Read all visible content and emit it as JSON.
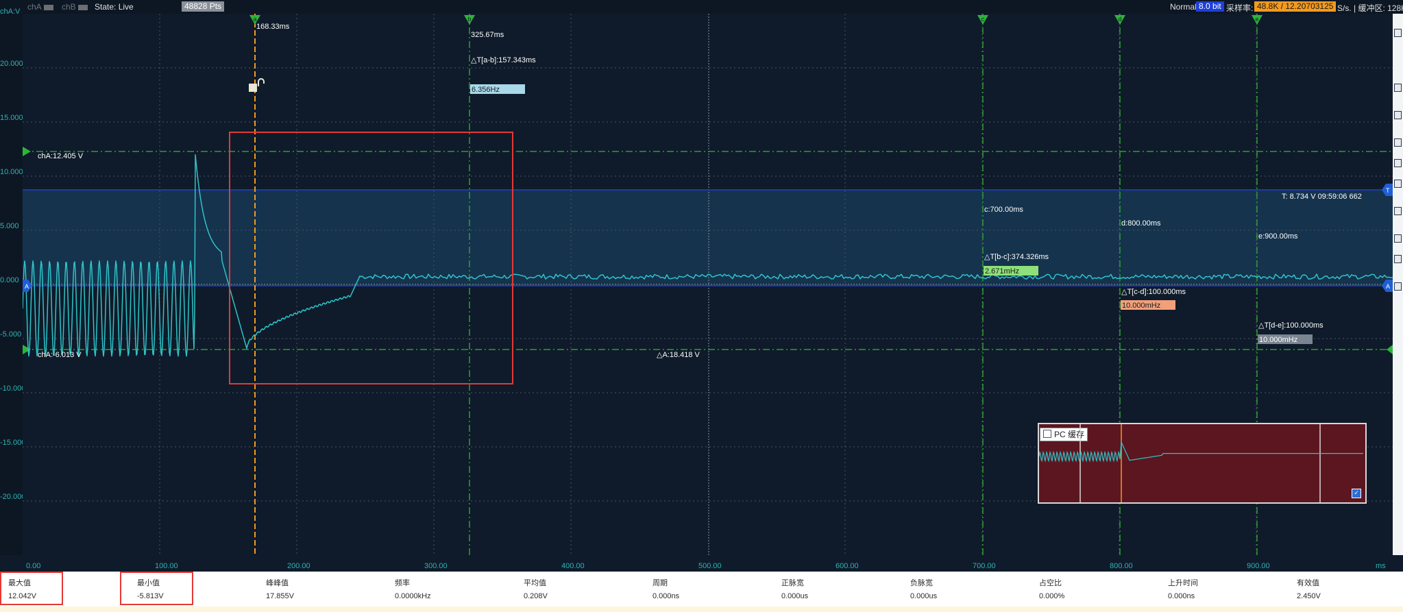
{
  "topbar": {
    "chA_label": "chA",
    "chB_label": "chB",
    "state": "State: Live",
    "points": "48828 Pts",
    "mode": "Normal",
    "bits": "8.0 bit",
    "sample_rate_label": "采样率:",
    "sample_rate_value": "48.8K / 12.20703125",
    "sample_rate_unit": "S/s. | 缓冲区: 128K"
  },
  "yaxis": {
    "unit": "chA:V",
    "labels": [
      "20.000",
      "15.000",
      "10.000",
      "5.000",
      "0.000",
      "-5.000",
      "-10.000",
      "-15.000",
      "-20.000"
    ]
  },
  "xaxis": {
    "labels": [
      "0.00",
      "100.00",
      "200.00",
      "300.00",
      "400.00",
      "500.00",
      "600.00",
      "700.00",
      "800.00",
      "900.00"
    ],
    "unit": "ms"
  },
  "cursors": {
    "a": {
      "letter": "a",
      "time": "168.33ms"
    },
    "b": {
      "letter": "b",
      "time": "325.67ms",
      "delta": "△T[a-b]:157.343ms",
      "freq": "6.356Hz"
    },
    "c": {
      "letter": "c",
      "time": "c:700.00ms",
      "delta": "△T[b-c]:374.326ms",
      "freq": "2.671mHz"
    },
    "d": {
      "letter": "d",
      "time": "d:800.00ms",
      "delta": "△T[c-d]:100.000ms",
      "freq": "10.000mHz"
    },
    "e": {
      "letter": "e",
      "time": "e:900.00ms",
      "delta": "△T[d-e]:100.000ms",
      "freq": "10.000mHz"
    }
  },
  "levels": {
    "upper": "chA:12.405 V",
    "lower": "chA:-6.013 V",
    "delta": "△A:18.418 V",
    "trigger": "T:  8.734 V   09:59:06 662",
    "trigger_marker": "T",
    "channel_marker": "A"
  },
  "mini_view": {
    "label": "PC 缓存",
    "check_mark": "✓"
  },
  "measurements": [
    {
      "label": "最大值",
      "value": "12.042V"
    },
    {
      "label": "最小值",
      "value": "-5.813V"
    },
    {
      "label": "峰峰值",
      "value": "17.855V"
    },
    {
      "label": "频率",
      "value": "0.0000kHz"
    },
    {
      "label": "平均值",
      "value": "0.208V"
    },
    {
      "label": "周期",
      "value": "0.000ns"
    },
    {
      "label": "正脉宽",
      "value": "0.000us"
    },
    {
      "label": "负脉宽",
      "value": "0.000us"
    },
    {
      "label": "占空比",
      "value": "0.000%"
    },
    {
      "label": "上升时间",
      "value": "0.000ns"
    },
    {
      "label": "有效值",
      "value": "2.450V"
    }
  ],
  "colors": {
    "trace": "#2ec4c9",
    "cursor_a": "#f39a1f",
    "cursor_other": "#2f9e2f",
    "trigger_line": "#1f3fd6",
    "highlight_box": "#e53935"
  }
}
